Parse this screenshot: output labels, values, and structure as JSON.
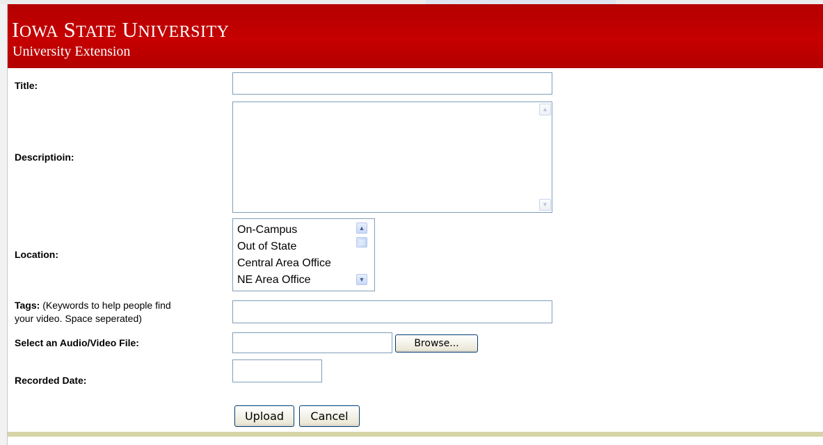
{
  "header": {
    "university": "Iowa State University",
    "department": "University Extension",
    "background_color": "#c00000"
  },
  "form": {
    "title_label": "Title:",
    "title_value": "",
    "description_label": "Descriptioin:",
    "description_value": "",
    "location_label": "Location:",
    "location_options": [
      "On-Campus",
      "Out of State",
      "Central Area Office",
      "NE Area Office"
    ],
    "tags_label": "Tags:",
    "tags_note_line1": " (Keywords to help people find",
    "tags_note_line2": "your video. Space seperated)",
    "tags_value": "",
    "file_label": "Select an Audio/Video File:",
    "file_value": "",
    "browse_label": "Browse...",
    "recorded_date_label": "Recorded Date:",
    "recorded_date_value": "",
    "upload_label": "Upload",
    "cancel_label": "Cancel"
  },
  "icons": {
    "scroll_up": "scroll-up-arrow-icon",
    "scroll_down": "scroll-down-arrow-icon"
  }
}
